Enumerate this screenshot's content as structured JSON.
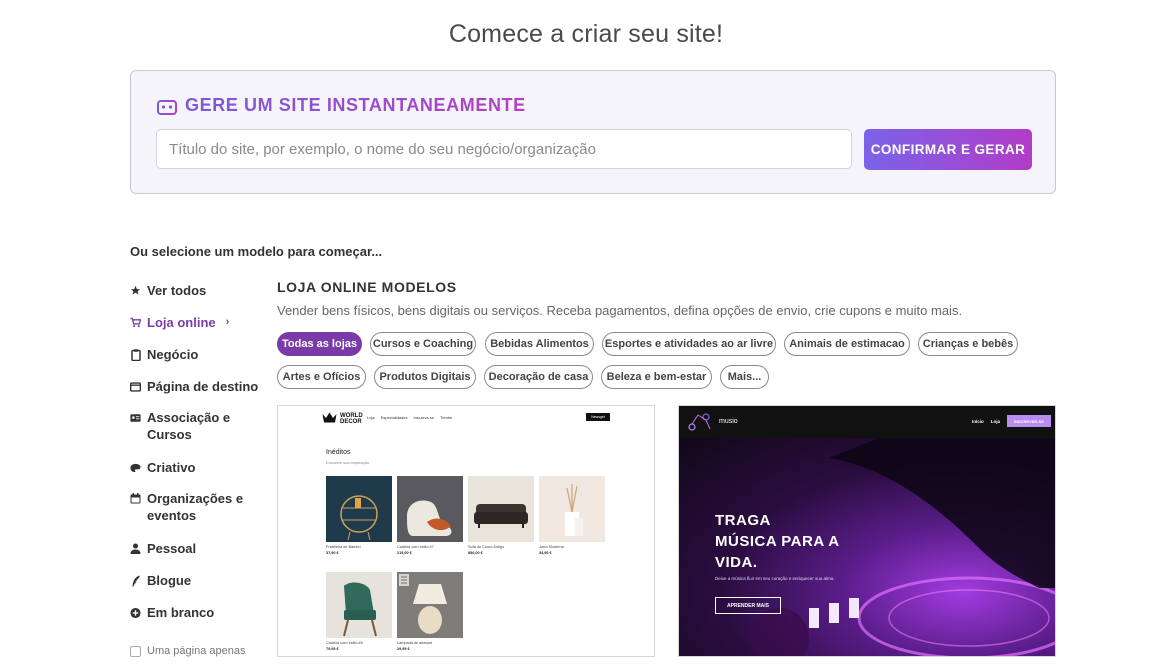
{
  "page": {
    "title": "Comece a criar seu site!"
  },
  "generator": {
    "title": "GERE UM SITE INSTANTANEAMENTE",
    "placeholder": "Título do site, por exemplo, o nome do seu negócio/organização",
    "button_label": "CONFIRMAR E GERAR"
  },
  "select_label": "Ou selecione um modelo para começar...",
  "sidebar": {
    "items": [
      {
        "label": "Ver todos",
        "icon": "star-icon"
      },
      {
        "label": "Loja online",
        "icon": "cart-icon",
        "active": true
      },
      {
        "label": "Negócio",
        "icon": "clipboard-icon"
      },
      {
        "label": "Página de destino",
        "icon": "window-icon"
      },
      {
        "label": "Associação e Cursos",
        "icon": "id-card-icon"
      },
      {
        "label": "Criativo",
        "icon": "palette-icon"
      },
      {
        "label": "Organizações e eventos",
        "icon": "calendar-icon"
      },
      {
        "label": "Pessoal",
        "icon": "person-icon"
      },
      {
        "label": "Blogue",
        "icon": "quill-icon"
      },
      {
        "label": "Em branco",
        "icon": "plus-circle-icon"
      }
    ],
    "single_page_label": "Uma página apenas"
  },
  "category": {
    "title": "LOJA ONLINE MODELOS",
    "description": "Vender bens físicos, bens digitais ou serviços. Receba pagamentos, defina opções de envio, crie cupons e muito mais."
  },
  "filters": [
    "Todas as lojas",
    "Cursos e Coaching",
    "Bebidas Alimentos",
    "Esportes e atividades ao ar livre",
    "Animais de estimacao",
    "Crianças e bebês",
    "Artes e Ofícios",
    "Produtos Digitais",
    "Decoração de casa",
    "Beleza e bem-estar",
    "Mais..."
  ],
  "template_a": {
    "logo": "WORLD DECOR",
    "nav": [
      "Loja",
      "Especialidades",
      "Inscreva-se",
      "Tienhe"
    ],
    "button": "Newsget",
    "heading": "Inéditos",
    "subheading": "Encontre sua inspiração.",
    "products": [
      {
        "name": "Prateleira de Bambu",
        "price": "37,90 €"
      },
      {
        "name": "Cadeira com estilo #7",
        "price": "215,00 €"
      },
      {
        "name": "Sofá de Couro Antigo",
        "price": "890,00 €"
      },
      {
        "name": "Jarra Moderna",
        "price": "34,90 €"
      },
      {
        "name": "Cadeira com estilo #5",
        "price": "79,95 €"
      },
      {
        "name": "Lâmpada de abacaxi",
        "price": "29,95 €"
      }
    ]
  },
  "template_b": {
    "logo": "musio",
    "nav": [
      "Início",
      "Loja"
    ],
    "cta": "INSCREVER-SE",
    "headline_1": "TRAGA",
    "headline_2": "MÚSICA PARA A",
    "headline_3": "VIDA.",
    "tagline": "Deixe a música fluir em seu coração e enriquecer sua alma.",
    "button": "APRENDER MAIS"
  },
  "colors": {
    "accent_purple": "#7a3aa8",
    "gradient_start": "#7a63e8",
    "gradient_end": "#b23cc8"
  }
}
